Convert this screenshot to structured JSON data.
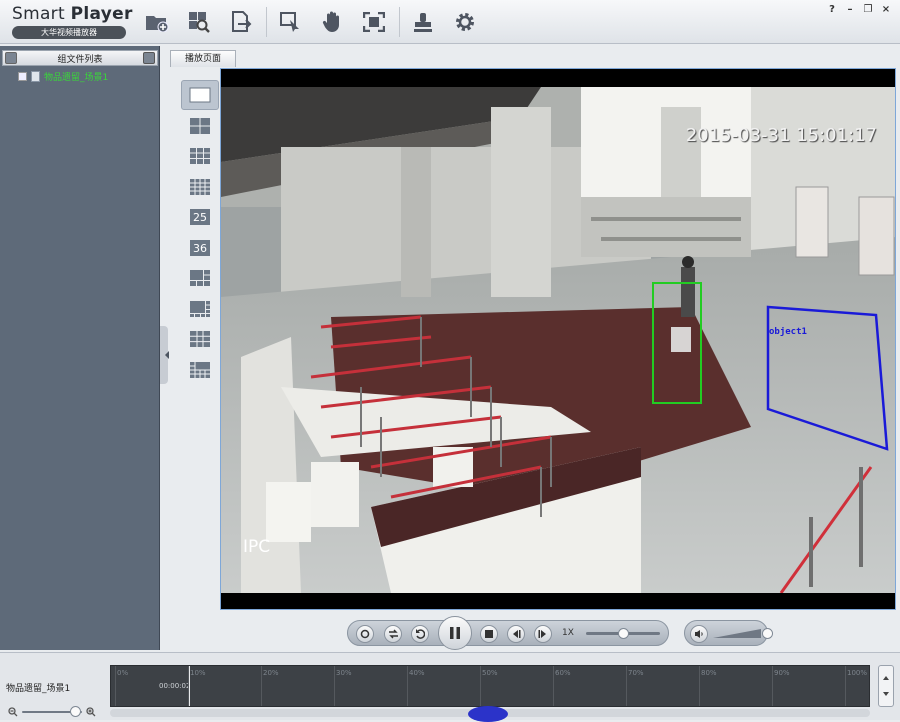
{
  "app": {
    "title_a": "Smart ",
    "title_b": "Player",
    "subtitle": "大华视频播放器"
  },
  "window_controls": [
    "?",
    "–",
    "❐",
    "×"
  ],
  "toolbar": [
    {
      "name": "open-folder-icon"
    },
    {
      "name": "search-file-icon"
    },
    {
      "name": "export-icon"
    },
    {
      "name": "smart-search-icon"
    },
    {
      "name": "hand-icon"
    },
    {
      "name": "fullscreen-icon"
    },
    {
      "name": "stamp-icon"
    },
    {
      "name": "settings-icon"
    }
  ],
  "left_panel": {
    "title": "组文件列表",
    "items": [
      {
        "label": "物品遗留_场景1"
      }
    ]
  },
  "tab": {
    "label": "播放页面"
  },
  "layouts": [
    {
      "name": "layout-1",
      "text": ""
    },
    {
      "name": "layout-4",
      "text": ""
    },
    {
      "name": "layout-9",
      "text": ""
    },
    {
      "name": "layout-16",
      "text": ""
    },
    {
      "name": "layout-25",
      "text": "25"
    },
    {
      "name": "layout-36",
      "text": "36"
    },
    {
      "name": "layout-6",
      "text": ""
    },
    {
      "name": "layout-8",
      "text": ""
    },
    {
      "name": "layout-9b",
      "text": ""
    },
    {
      "name": "layout-13",
      "text": ""
    }
  ],
  "video": {
    "timestamp": "2015-03-31 15:01:17",
    "channel_label": "IPC",
    "object_label": "object1",
    "person_box_color": "#22cc22",
    "region_color": "#1a1ad8"
  },
  "playback": {
    "speed": "1X",
    "progress": 0.4,
    "volume": 0.6
  },
  "timeline": {
    "track_label": "物品遗留_场景1",
    "current_time": "00:00:02",
    "ticks": [
      "0%",
      "10%",
      "20%",
      "30%",
      "40%",
      "50%",
      "60%",
      "70%",
      "80%",
      "90%",
      "100%"
    ]
  }
}
